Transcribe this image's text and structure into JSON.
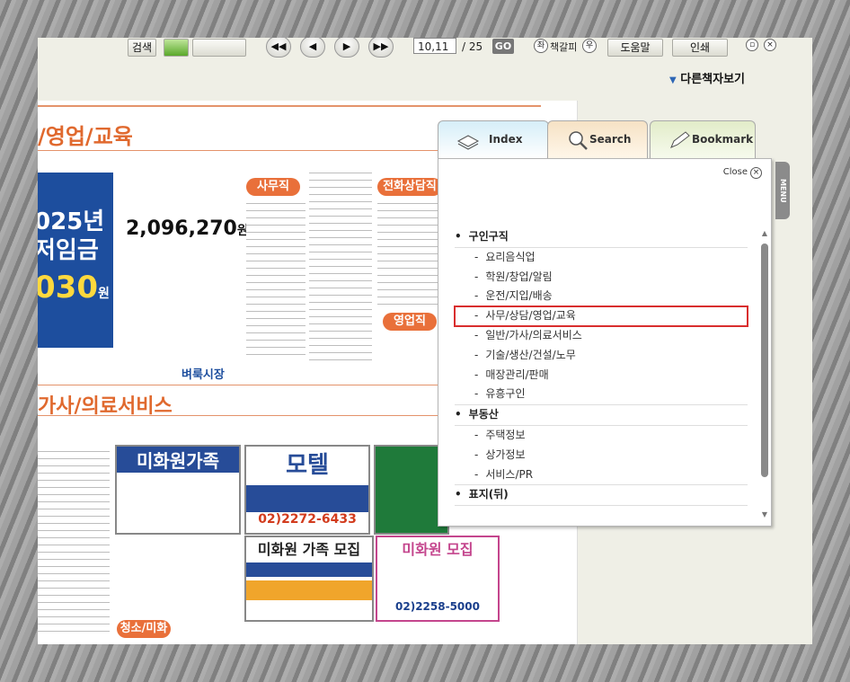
{
  "toolbar": {
    "search_label": "검색",
    "page_value": "10,11",
    "page_total": "/ 25",
    "go_label": "GO",
    "left_toggle": "좌",
    "bookmark_label": "책갈피",
    "right_toggle": "우",
    "help_label": "도움말",
    "print_label": "인쇄"
  },
  "other_books_label": "다른책자보기",
  "newspaper": {
    "title_top": "/영업/교육",
    "title_mid": "가사/의료서비스",
    "year_text": "025년",
    "wage_text": "저임금",
    "wage_big": "030",
    "wage_unit": "원",
    "wage_figure": "2,096,270",
    "wage_figure_unit": "원",
    "publisher": "벼룩시장",
    "tag_office": "사무직",
    "tag_phone": "전화상담직",
    "tag_sales": "영업직",
    "tag_cleaning": "청소/미화",
    "ad_mihwawon": "미화원가족",
    "ad_motel": "모텔",
    "ad_motel_phone": "02)2272-6433",
    "ad_mihwa_family": "미화원 가족 모집",
    "ad_mihwa_recruit": "미화원 모집",
    "ad_mihwa_recruit_phone": "02)2258-5000"
  },
  "panel": {
    "tabs": {
      "index": "Index",
      "search": "Search",
      "bookmark": "Bookmark"
    },
    "close_label": "Close",
    "menu_label": "MENU",
    "items": [
      {
        "label": "구인구직",
        "type": "cat"
      },
      {
        "label": "요리음식업",
        "type": "sub"
      },
      {
        "label": "학원/창업/알림",
        "type": "sub"
      },
      {
        "label": "운전/지입/배송",
        "type": "sub"
      },
      {
        "label": "사무/상담/영업/교육",
        "type": "sub",
        "highlighted": true
      },
      {
        "label": "일반/가사/의료서비스",
        "type": "sub"
      },
      {
        "label": "기술/생산/건설/노무",
        "type": "sub"
      },
      {
        "label": "매장관리/판매",
        "type": "sub"
      },
      {
        "label": "유흥구인",
        "type": "sub"
      },
      {
        "label": "부동산",
        "type": "cat"
      },
      {
        "label": "주택정보",
        "type": "sub"
      },
      {
        "label": "상가정보",
        "type": "sub"
      },
      {
        "label": "서비스/PR",
        "type": "sub"
      },
      {
        "label": "표지(뒤)",
        "type": "cat"
      }
    ]
  },
  "colors": {
    "accent_orange": "#e0692e",
    "highlight_red": "#d92e2e",
    "paper_blue": "#1d4e9e"
  }
}
